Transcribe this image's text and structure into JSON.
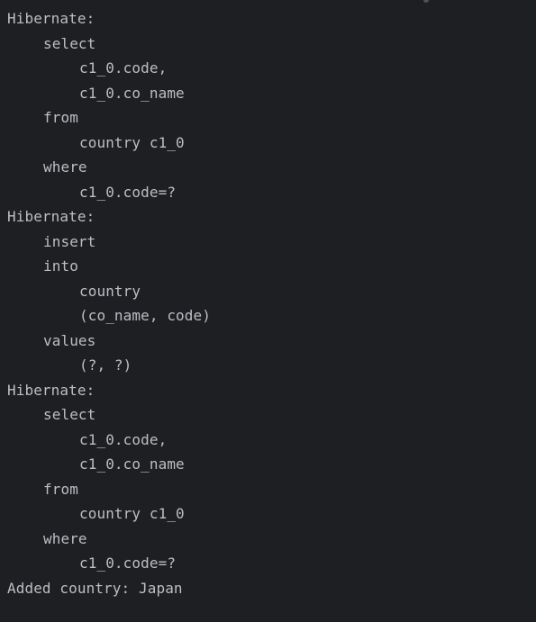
{
  "console": {
    "lines": [
      {
        "indent": 0,
        "text": "Hibernate:"
      },
      {
        "indent": 1,
        "text": "select"
      },
      {
        "indent": 2,
        "text": "c1_0.code,"
      },
      {
        "indent": 2,
        "text": "c1_0.co_name"
      },
      {
        "indent": 1,
        "text": "from"
      },
      {
        "indent": 2,
        "text": "country c1_0"
      },
      {
        "indent": 1,
        "text": "where"
      },
      {
        "indent": 2,
        "text": "c1_0.code=?"
      },
      {
        "indent": 0,
        "text": "Hibernate:"
      },
      {
        "indent": 1,
        "text": "insert"
      },
      {
        "indent": 1,
        "text": "into"
      },
      {
        "indent": 2,
        "text": "country"
      },
      {
        "indent": 2,
        "text": "(co_name, code)"
      },
      {
        "indent": 1,
        "text": "values"
      },
      {
        "indent": 2,
        "text": "(?, ?)"
      },
      {
        "indent": 0,
        "text": "Hibernate:"
      },
      {
        "indent": 1,
        "text": "select"
      },
      {
        "indent": 2,
        "text": "c1_0.code,"
      },
      {
        "indent": 2,
        "text": "c1_0.co_name"
      },
      {
        "indent": 1,
        "text": "from"
      },
      {
        "indent": 2,
        "text": "country c1_0"
      },
      {
        "indent": 1,
        "text": "where"
      },
      {
        "indent": 2,
        "text": "c1_0.code=?"
      },
      {
        "indent": 0,
        "text": "Added country: Japan"
      }
    ]
  },
  "colors": {
    "background": "#1e1f22",
    "text": "#bcbec4"
  }
}
